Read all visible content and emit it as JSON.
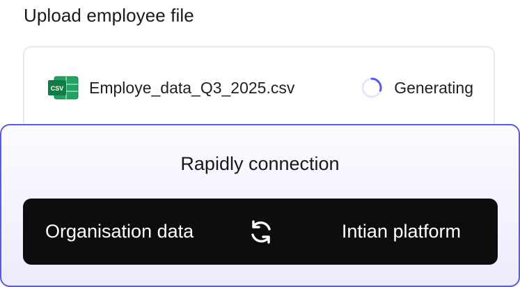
{
  "section": {
    "title": "Upload employee file"
  },
  "file": {
    "icon": "csv-file-icon",
    "icon_label": "CSV",
    "name": "Employe_data_Q3_2025.csv",
    "status_icon": "loading-spinner-icon",
    "status": "Generating"
  },
  "connection": {
    "title": "Rapidly connection",
    "source": "Organisation data",
    "sync_icon": "sync-icon",
    "target": "Intian platform"
  },
  "colors": {
    "accent": "#5b57e8",
    "csv_green": "#1e8e3e",
    "bar_background": "#0d0d0f"
  }
}
